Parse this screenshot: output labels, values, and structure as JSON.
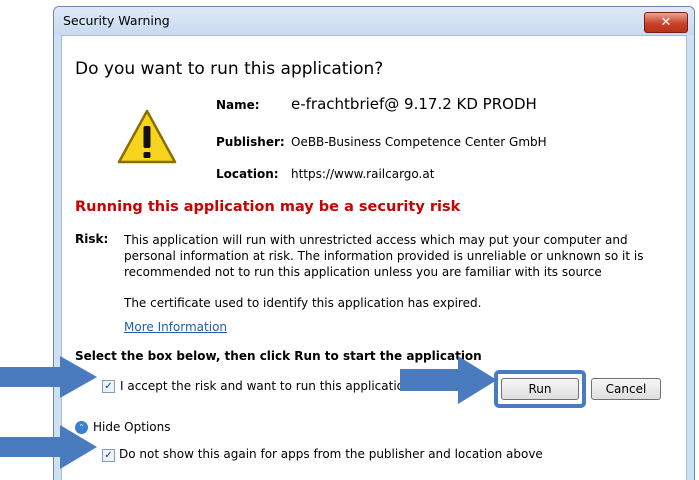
{
  "window": {
    "title": "Security Warning",
    "close_label": "✕"
  },
  "heading": "Do you want to run this application?",
  "info": {
    "name_label": "Name:",
    "name_value": "e-frachtbrief@ 9.17.2 KD PRODH",
    "publisher_label": "Publisher:",
    "publisher_value": "OeBB-Business Competence Center GmbH",
    "location_label": "Location:",
    "location_value": "https://www.railcargo.at"
  },
  "risk": {
    "title": "Running this application may be a security risk",
    "label": "Risk:",
    "text": "This application will run with unrestricted access which may put your computer and personal information at risk. The information provided is unreliable or unknown so it is recommended not to run this application unless you are familiar with its source",
    "certificate": "The certificate used to identify this application has expired.",
    "more_info": "More Information"
  },
  "instructions": "Select the box below, then click Run to start the application",
  "accept": {
    "checked": true,
    "check_glyph": "✓",
    "label": "I accept the risk and want to run this application."
  },
  "buttons": {
    "run": "Run",
    "cancel": "Cancel"
  },
  "options": {
    "hide_label": "Hide Options",
    "hide_icon_glyph": "⌃"
  },
  "dont_show": {
    "checked": true,
    "check_glyph": "✓",
    "label": "Do not show this again for apps from the publisher and location above"
  },
  "colors": {
    "risk_title": "#cc0000",
    "annotation_arrow": "#4a7bbf",
    "link": "#1f5f9f"
  }
}
